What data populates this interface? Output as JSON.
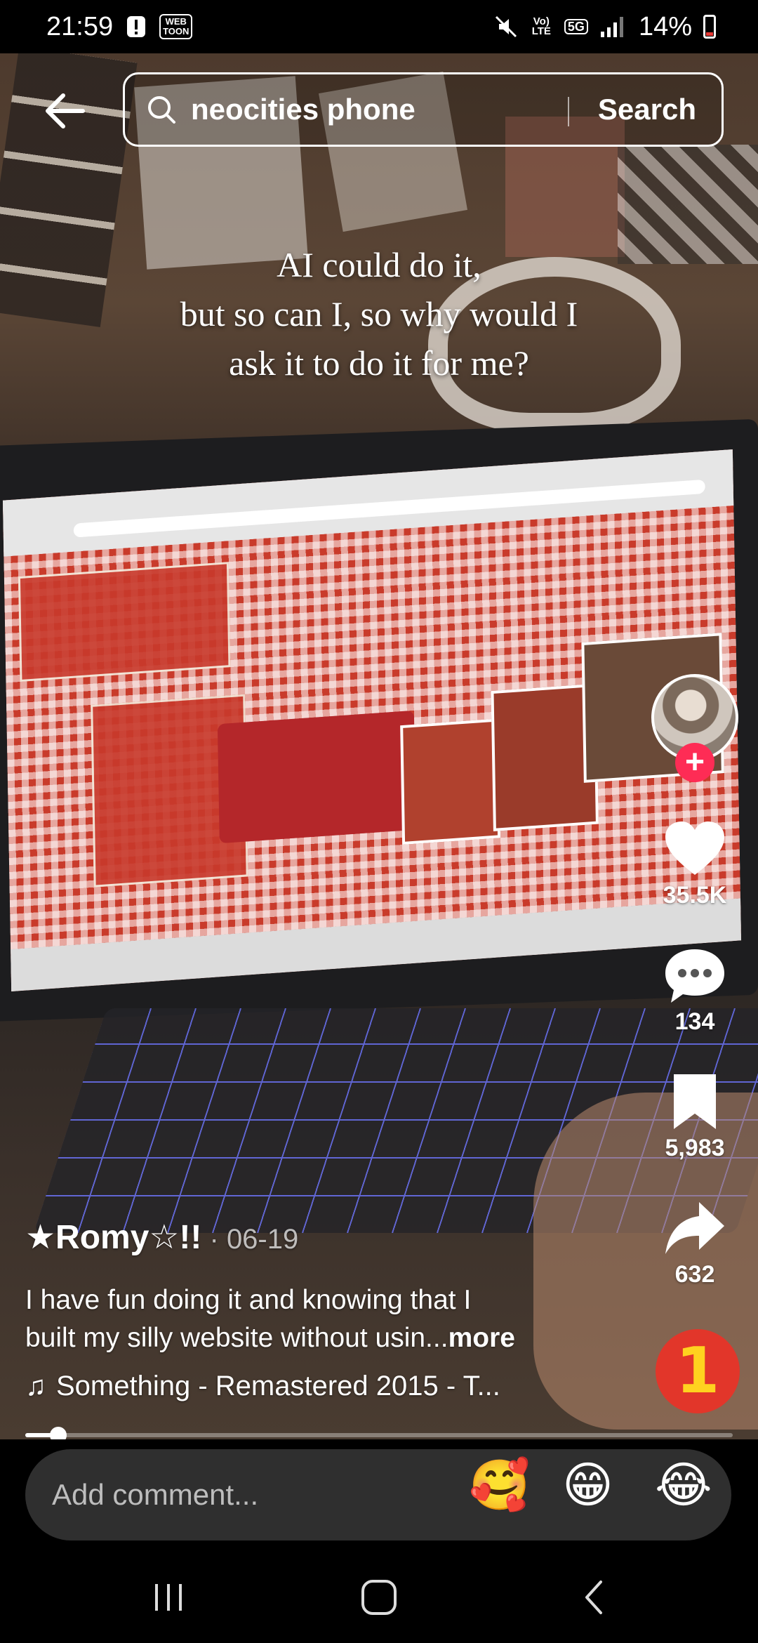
{
  "status_bar": {
    "time": "21:59",
    "notification_icons": [
      "alert-icon",
      "webtoon-icon"
    ],
    "webtoon_badge": "WEB\nTOON",
    "network_label": "Vo)\nLTE",
    "network_type": "5G",
    "battery": "14%",
    "battery_color": "#e53935"
  },
  "search": {
    "query": "neocities phone",
    "button_label": "Search"
  },
  "video": {
    "overlay_lines": [
      "AI could do it,",
      "but so can I, so why would I",
      "ask it to do it for me?"
    ]
  },
  "actions": {
    "likes": "35.5K",
    "comments": "134",
    "bookmarks": "5,983",
    "shares": "632",
    "follow_symbol": "+",
    "follow_color": "#fe2c55",
    "sticker_label": "1"
  },
  "caption": {
    "author": "★Romy☆!!",
    "date": " · 06-19",
    "text_line1": "I have fun doing it and knowing that I",
    "text_line2": "built my silly website without usin...",
    "more_label": "more",
    "music_icon": "♫",
    "music": "Something - Remastered 2015 - T..."
  },
  "progress": {
    "fraction": 0.047
  },
  "comment_bar": {
    "placeholder": "Add comment...",
    "emojis": [
      "🥰",
      "😁",
      "😂"
    ]
  },
  "nav": {
    "icons": [
      "recents-icon",
      "home-icon",
      "back-nav-icon"
    ]
  }
}
